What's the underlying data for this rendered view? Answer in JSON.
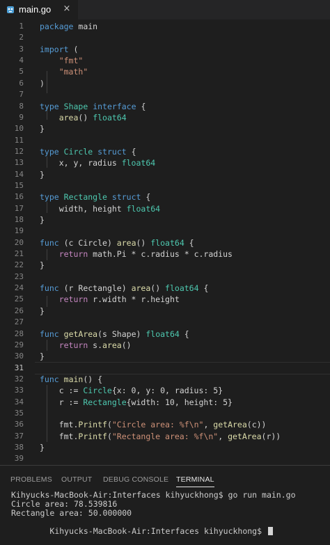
{
  "editor_tab": {
    "filename": "main.go",
    "close_glyph": "×",
    "icon": "go-file-icon"
  },
  "colors": {
    "keyword": "#569cd6",
    "type": "#4ec9b0",
    "string": "#ce9178",
    "control": "#c586c0",
    "function": "#dcdcaa",
    "text": "#d4d4d4",
    "line_number": "#858585",
    "background": "#1e1e1e",
    "tabbar": "#252526"
  },
  "code_lines": [
    {
      "n": "1",
      "t": [
        [
          "kw",
          "package"
        ],
        [
          "id",
          " main"
        ]
      ]
    },
    {
      "n": "2",
      "t": []
    },
    {
      "n": "3",
      "t": [
        [
          "kw",
          "import"
        ],
        [
          "id",
          " ("
        ]
      ]
    },
    {
      "n": "4",
      "t": [
        [
          "id",
          "    "
        ],
        [
          "str",
          "\"fmt\""
        ]
      ]
    },
    {
      "n": "5",
      "t": [
        [
          "id",
          "    "
        ],
        [
          "str",
          "\"math\""
        ]
      ]
    },
    {
      "n": "6",
      "t": [
        [
          "id",
          ")"
        ]
      ]
    },
    {
      "n": "7",
      "t": []
    },
    {
      "n": "8",
      "t": [
        [
          "kw",
          "type"
        ],
        [
          "id",
          " "
        ],
        [
          "type",
          "Shape"
        ],
        [
          "id",
          " "
        ],
        [
          "kw",
          "interface"
        ],
        [
          "id",
          " {"
        ]
      ]
    },
    {
      "n": "9",
      "t": [
        [
          "id",
          "    "
        ],
        [
          "fn",
          "area"
        ],
        [
          "id",
          "() "
        ],
        [
          "type",
          "float64"
        ]
      ]
    },
    {
      "n": "10",
      "t": [
        [
          "id",
          "}"
        ]
      ]
    },
    {
      "n": "11",
      "t": []
    },
    {
      "n": "12",
      "t": [
        [
          "kw",
          "type"
        ],
        [
          "id",
          " "
        ],
        [
          "type",
          "Circle"
        ],
        [
          "id",
          " "
        ],
        [
          "kw",
          "struct"
        ],
        [
          "id",
          " {"
        ]
      ]
    },
    {
      "n": "13",
      "t": [
        [
          "id",
          "    x, y, radius "
        ],
        [
          "type",
          "float64"
        ]
      ]
    },
    {
      "n": "14",
      "t": [
        [
          "id",
          "}"
        ]
      ]
    },
    {
      "n": "15",
      "t": []
    },
    {
      "n": "16",
      "t": [
        [
          "kw",
          "type"
        ],
        [
          "id",
          " "
        ],
        [
          "type",
          "Rectangle"
        ],
        [
          "id",
          " "
        ],
        [
          "kw",
          "struct"
        ],
        [
          "id",
          " {"
        ]
      ]
    },
    {
      "n": "17",
      "t": [
        [
          "id",
          "    width, height "
        ],
        [
          "type",
          "float64"
        ]
      ]
    },
    {
      "n": "18",
      "t": [
        [
          "id",
          "}"
        ]
      ]
    },
    {
      "n": "19",
      "t": []
    },
    {
      "n": "20",
      "t": [
        [
          "kw",
          "func"
        ],
        [
          "id",
          " (c Circle) "
        ],
        [
          "fn",
          "area"
        ],
        [
          "id",
          "() "
        ],
        [
          "type",
          "float64"
        ],
        [
          "id",
          " {"
        ]
      ]
    },
    {
      "n": "21",
      "t": [
        [
          "id",
          "    "
        ],
        [
          "ctl",
          "return"
        ],
        [
          "id",
          " math.Pi * c.radius * c.radius"
        ]
      ]
    },
    {
      "n": "22",
      "t": [
        [
          "id",
          "}"
        ]
      ]
    },
    {
      "n": "23",
      "t": []
    },
    {
      "n": "24",
      "t": [
        [
          "kw",
          "func"
        ],
        [
          "id",
          " (r Rectangle) "
        ],
        [
          "fn",
          "area"
        ],
        [
          "id",
          "() "
        ],
        [
          "type",
          "float64"
        ],
        [
          "id",
          " {"
        ]
      ]
    },
    {
      "n": "25",
      "t": [
        [
          "id",
          "    "
        ],
        [
          "ctl",
          "return"
        ],
        [
          "id",
          " r.width * r.height"
        ]
      ]
    },
    {
      "n": "26",
      "t": [
        [
          "id",
          "}"
        ]
      ]
    },
    {
      "n": "27",
      "t": []
    },
    {
      "n": "28",
      "t": [
        [
          "kw",
          "func"
        ],
        [
          "id",
          " "
        ],
        [
          "fn",
          "getArea"
        ],
        [
          "id",
          "(s Shape) "
        ],
        [
          "type",
          "float64"
        ],
        [
          "id",
          " {"
        ]
      ]
    },
    {
      "n": "29",
      "t": [
        [
          "id",
          "    "
        ],
        [
          "ctl",
          "return"
        ],
        [
          "id",
          " s."
        ],
        [
          "fn",
          "area"
        ],
        [
          "id",
          "()"
        ]
      ]
    },
    {
      "n": "30",
      "t": [
        [
          "id",
          "}"
        ]
      ]
    },
    {
      "n": "31",
      "t": [],
      "current": true
    },
    {
      "n": "32",
      "t": [
        [
          "kw",
          "func"
        ],
        [
          "id",
          " "
        ],
        [
          "fn",
          "main"
        ],
        [
          "id",
          "() {"
        ]
      ]
    },
    {
      "n": "33",
      "t": [
        [
          "id",
          "    c := "
        ],
        [
          "type",
          "Circle"
        ],
        [
          "id",
          "{x: 0, y: 0, radius: 5}"
        ]
      ]
    },
    {
      "n": "34",
      "t": [
        [
          "id",
          "    r := "
        ],
        [
          "type",
          "Rectangle"
        ],
        [
          "id",
          "{width: 10, height: 5}"
        ]
      ]
    },
    {
      "n": "35",
      "t": []
    },
    {
      "n": "36",
      "t": [
        [
          "id",
          "    fmt."
        ],
        [
          "fn",
          "Printf"
        ],
        [
          "id",
          "("
        ],
        [
          "str",
          "\"Circle area: %f\\n\""
        ],
        [
          "id",
          ", "
        ],
        [
          "fn",
          "getArea"
        ],
        [
          "id",
          "(c))"
        ]
      ]
    },
    {
      "n": "37",
      "t": [
        [
          "id",
          "    fmt."
        ],
        [
          "fn",
          "Printf"
        ],
        [
          "id",
          "("
        ],
        [
          "str",
          "\"Rectangle area: %f\\n\""
        ],
        [
          "id",
          ", "
        ],
        [
          "fn",
          "getArea"
        ],
        [
          "id",
          "(r))"
        ]
      ]
    },
    {
      "n": "38",
      "t": [
        [
          "id",
          "}"
        ]
      ]
    },
    {
      "n": "39",
      "t": []
    }
  ],
  "panel": {
    "tabs": [
      "PROBLEMS",
      "OUTPUT",
      "DEBUG CONSOLE",
      "TERMINAL"
    ],
    "active_tab": "TERMINAL",
    "terminal_lines": [
      "Kihyucks-MacBook-Air:Interfaces kihyuckhong$ go run main.go",
      "Circle area: 78.539816",
      "Rectangle area: 50.000000",
      "Kihyucks-MacBook-Air:Interfaces kihyuckhong$ "
    ]
  }
}
